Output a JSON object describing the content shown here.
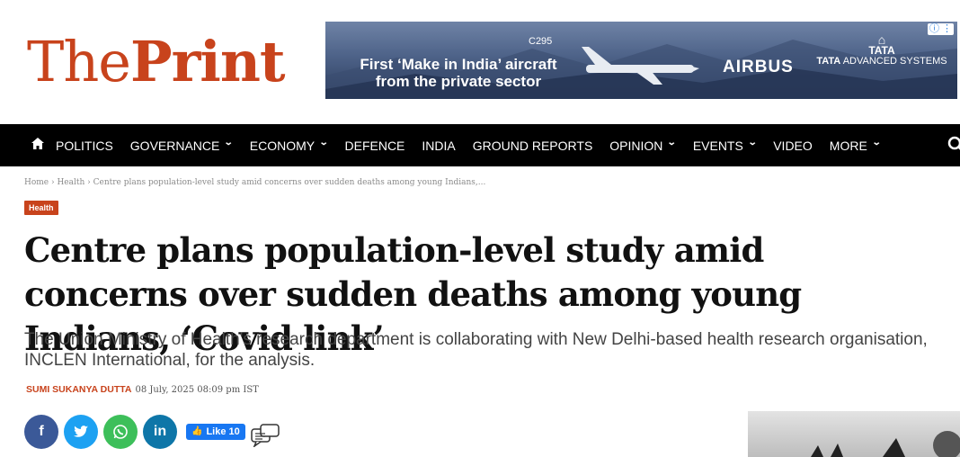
{
  "logo": {
    "the": "The",
    "print": "Print"
  },
  "ad": {
    "model": "C295",
    "headline_line1": "First ‘Make in India’ aircraft",
    "headline_line2": "from the private sector",
    "brand1": "AIRBUS",
    "brand2_logo": "TATA",
    "brand2_name_bold": "TATA",
    "brand2_name_rest": " ADVANCED SYSTEMS",
    "info": "ⓘ ⋮"
  },
  "nav": {
    "items": [
      {
        "label": "POLITICS",
        "dropdown": false
      },
      {
        "label": "GOVERNANCE",
        "dropdown": true
      },
      {
        "label": "ECONOMY",
        "dropdown": true
      },
      {
        "label": "DEFENCE",
        "dropdown": false
      },
      {
        "label": "INDIA",
        "dropdown": false
      },
      {
        "label": "GROUND REPORTS",
        "dropdown": false
      },
      {
        "label": "OPINION",
        "dropdown": true
      },
      {
        "label": "EVENTS",
        "dropdown": true
      },
      {
        "label": "VIDEO",
        "dropdown": false
      },
      {
        "label": "MORE",
        "dropdown": true
      }
    ]
  },
  "breadcrumb": "Home › Health › Centre plans population-level study amid concerns over sudden deaths among young Indians,...",
  "category_tag": "Health",
  "article": {
    "title": "Centre plans population-level study amid concerns over sudden deaths among young Indians, ‘Covid link’",
    "dek": "The Union Ministry of Health's research department is collaborating with New Delhi-based health research organisation, INCLEN International, for the analysis.",
    "author": "SUMI SUKANYA DUTTA",
    "date": "08 July, 2025 08:09 pm IST"
  },
  "share": {
    "facebook": "f",
    "twitter": "🐦",
    "whatsapp": "✆",
    "linkedin": "in",
    "like_label": "Like 10"
  },
  "colors": {
    "brand": "#c8431c",
    "nav_bg": "#000000"
  }
}
